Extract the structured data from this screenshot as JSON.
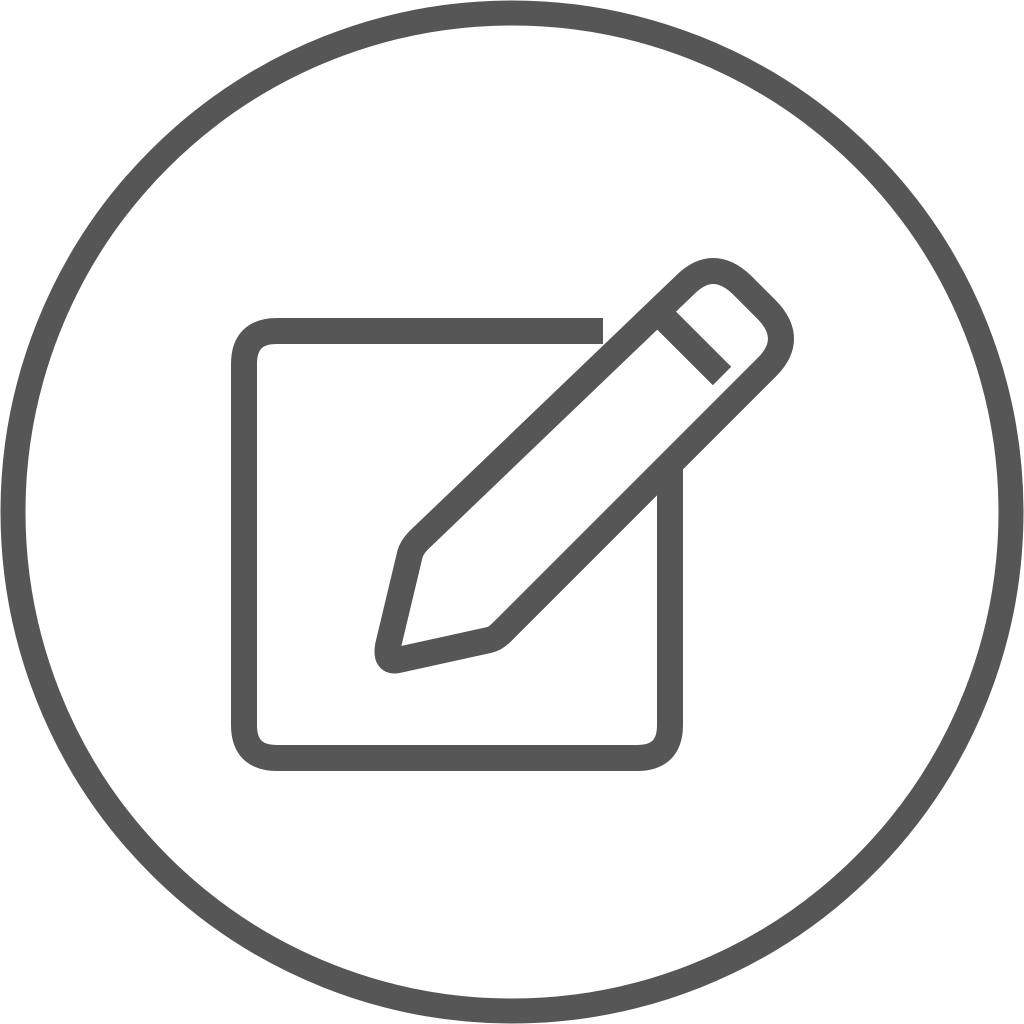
{
  "icon": {
    "name": "edit-icon",
    "stroke_color": "#565656",
    "background_color": "#ffffff"
  }
}
